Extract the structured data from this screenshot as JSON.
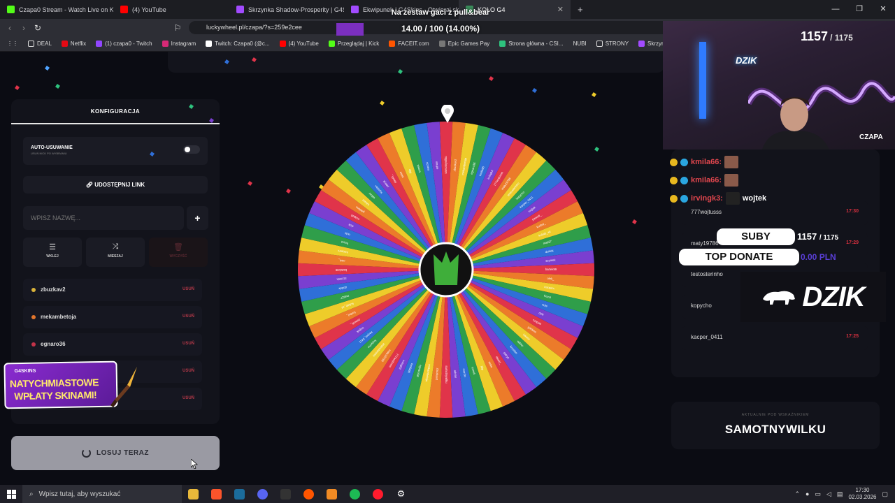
{
  "browser": {
    "tabs": [
      {
        "title": "Czapa0 Stream - Watch Live on Kick",
        "color": "#53fc18"
      },
      {
        "title": "(4) YouTube",
        "color": "#ff0000"
      },
      {
        "title": "Skrzynka Shadow-Prosperity | G4Skin",
        "color": "#a24bff"
      },
      {
        "title": "Ekwipunek | G4Skins - Otwieraj skrzy",
        "color": "#a24bff"
      },
      {
        "title": "KOŁO G4",
        "color": "#3a8a5a"
      }
    ],
    "url": "luckywheel.pl/czapa/?s=259e2cee",
    "bookmarks": [
      "DEAL",
      "Netflix",
      "(1) czapa0 - Twitch",
      "Instagram",
      "Twitch: Czapa0 (@c...",
      "(4) YouTube",
      "Przeglądaj | Kick",
      "FACEIT.com",
      "Epic Games Pay",
      "Strona główna - CSI...",
      "NUBI",
      "STRONY",
      "Skrzynki CS:..."
    ]
  },
  "overlay": {
    "goal_text": "Na zestaw gaci z pull&bear",
    "goal_progress": "14.00 / 100 (14.00%)",
    "sub_current": "1157",
    "sub_goal": "/ 1175",
    "brand_small": "DZIK",
    "streamer": "CZAPA",
    "suby_label": "SUBY",
    "suby_current": "1157",
    "suby_goal": "/ 1175",
    "top_donate_label": "TOP DONATE",
    "top_donate_value": "0.00 PLN",
    "brand_big": "DZIK"
  },
  "chat": [
    {
      "user": "kmila66:",
      "msg": ""
    },
    {
      "user": "kmila66:",
      "msg": ""
    },
    {
      "user": "irvingk3:",
      "msg": "wojtek"
    }
  ],
  "config": {
    "header": "KONFIGURACJA",
    "auto_remove_label": "AUTO-USUWANIE",
    "auto_remove_sub": "USUŃ NICK PO WYBRANIU",
    "auto_remove_on": false,
    "share_label": "UDOSTĘPNIJ LINK",
    "name_placeholder": "WPISZ NAZWĘ...",
    "add_label": "+",
    "paste_label": "WKLEJ",
    "shuffle_label": "MIESZAJ",
    "clear_label": "WYCZYŚĆ",
    "remove_label": "USUŃ",
    "entries": [
      {
        "name": "zbuzkav2",
        "color": "#d9b23a"
      },
      {
        "name": "mekambetoja",
        "color": "#e2752c"
      },
      {
        "name": "egnaro36",
        "color": "#c33349"
      },
      {
        "name": "",
        "color": "#7a4ad6"
      },
      {
        "name": "",
        "color": "#3a9ad6"
      }
    ],
    "spin_label": "LOSUJ TERAZ"
  },
  "promo": {
    "brand": "G4SKINS",
    "line1": "NATYCHMIASTOWE",
    "line2": "WPŁATY SKINAMI!"
  },
  "leaderboard": [
    {
      "name": "777wojtusss",
      "time": "17:30"
    },
    {
      "name": "maty19786",
      "time": "17:29"
    },
    {
      "name": "testosterinho",
      "time": ""
    },
    {
      "name": "kopycho",
      "time": ""
    },
    {
      "name": "kacper_0411",
      "time": "17:25"
    }
  ],
  "pointer_panel": {
    "subtitle": "AKTUALNIE POD WSKAŹNIKIEM",
    "value": "SAMOTNYWILKU"
  },
  "taskbar": {
    "search_placeholder": "Wpisz tutaj, aby wyszukać",
    "time": "17:30",
    "date": "02.03.2026"
  },
  "wheel": {
    "palette": [
      "#e0344a",
      "#ec7b2a",
      "#eecc2a",
      "#2f9e4a",
      "#2f6fd8",
      "#7a3fd0"
    ],
    "labels": [
      "samotnywilku",
      "zbuzkav2",
      "mekambetoja",
      "egnaro36",
      "kmila66",
      "irvingk3",
      "777wojtusss",
      "maty19786",
      "testosterinho",
      "kopycho",
      "kacper_0411",
      "wojtek",
      "pawcik_",
      "korbul_",
      "kubab_xd",
      "mati27",
      "dzidek",
      "szymek",
      "bartek99",
      "olek_",
      "kacperx",
      "frezol",
      "nubi",
      "dzik",
      "czapa0",
      "g4skins",
      "lukasz",
      "wiktor",
      "krystian",
      "patryk",
      "dawid_",
      "seba",
      "filip",
      "tomek",
      "marcin",
      "adrian"
    ],
    "segments": 72
  }
}
